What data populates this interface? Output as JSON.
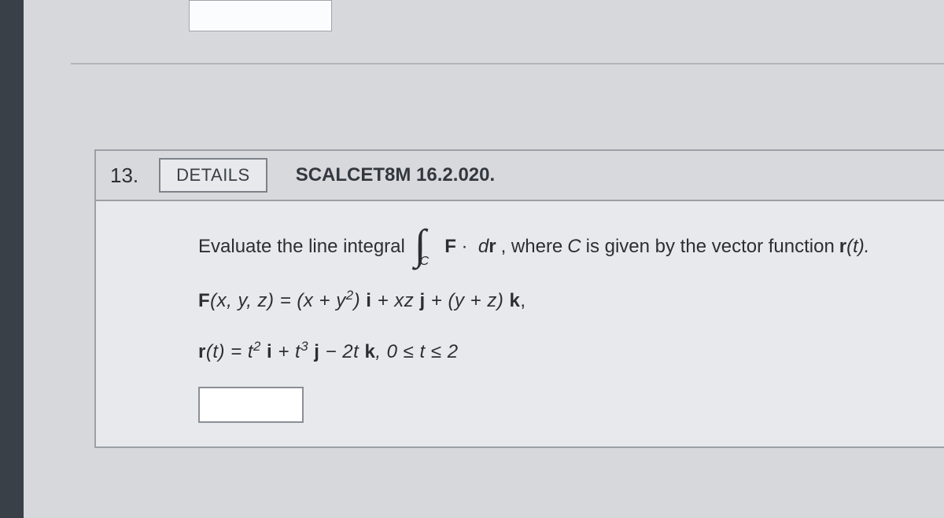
{
  "problem": {
    "number": "13.",
    "details_label": "DETAILS",
    "source": "SCALCET8M 16.2.020.",
    "prompt_before": "Evaluate the line integral",
    "integral_subscript": "C",
    "integrand_F": "F",
    "integrand_dot": "·",
    "integrand_dr": "dr",
    "prompt_after_1": ",  where",
    "curve_var": "C",
    "prompt_after_2": "is given by the vector function",
    "vector_fn": "r",
    "vector_fn_arg": "(t).",
    "line_F_lhs_F": "F",
    "line_F_lhs_args": "(x, y, z) = (x + y",
    "line_F_exp1": "2",
    "line_F_mid1": ") ",
    "line_F_i": "i",
    "line_F_plus_xz": " + xz ",
    "line_F_j": "j",
    "line_F_plus_yz": " + (y + z) ",
    "line_F_k": "k",
    "line_F_comma": ",",
    "line_r_r": "r",
    "line_r_t_eq": "(t) = t",
    "line_r_exp2": "2",
    "line_r_sp_i": " ",
    "line_r_i": "i",
    "line_r_plus_t": " + t",
    "line_r_exp3": "3",
    "line_r_sp_j": " ",
    "line_r_j": "j",
    "line_r_minus_2t": " − 2t ",
    "line_r_k": "k",
    "line_r_range": ",  0 ≤ t ≤ 2"
  }
}
